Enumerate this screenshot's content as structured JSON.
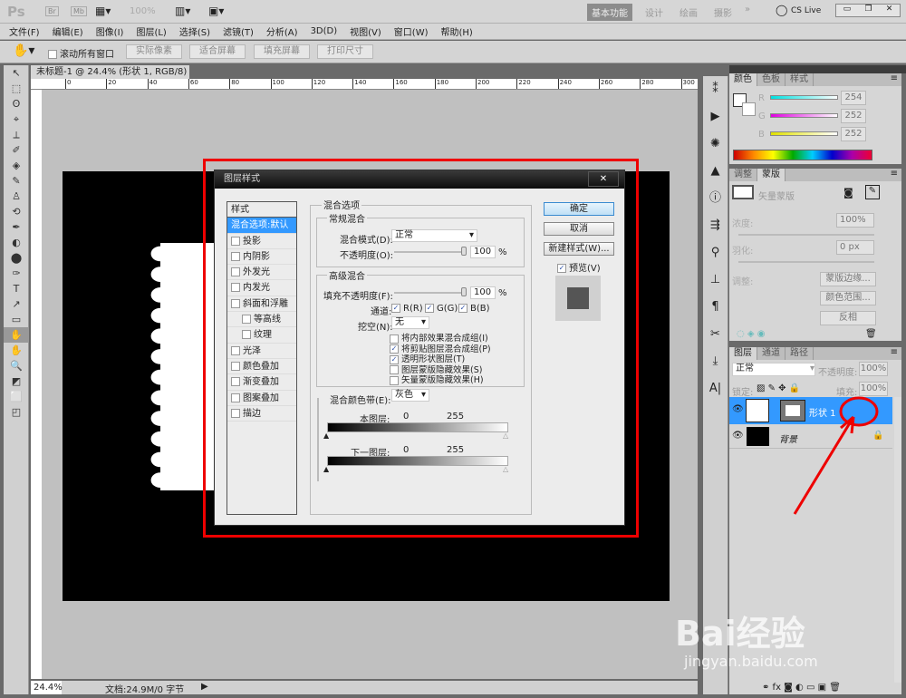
{
  "appbar": {
    "logo": "Ps",
    "br": "Br",
    "mb": "Mb",
    "zoom": "100%",
    "workspaces": [
      "基本功能",
      "设计",
      "绘画",
      "摄影"
    ],
    "more": "»",
    "cslive": "CS Live"
  },
  "menu": [
    "文件(F)",
    "编辑(E)",
    "图像(I)",
    "图层(L)",
    "选择(S)",
    "滤镜(T)",
    "分析(A)",
    "3D(D)",
    "视图(V)",
    "窗口(W)",
    "帮助(H)"
  ],
  "options": {
    "scroll_all": "滚动所有窗口",
    "buttons": [
      "实际像素",
      "适合屏幕",
      "填充屏幕",
      "打印尺寸"
    ]
  },
  "document": {
    "tab": "未标题-1 @ 24.4% (形状 1, RGB/8) *",
    "ruler_labels": [
      "0",
      "20",
      "40",
      "60",
      "80",
      "100",
      "120",
      "140",
      "160",
      "180",
      "200",
      "220",
      "240",
      "260",
      "280",
      "300"
    ]
  },
  "status": {
    "zoom": "24.4%",
    "doc": "文档:24.9M/0 字节"
  },
  "dialog": {
    "title": "图层样式",
    "close": "✕",
    "styles_header": "样式",
    "styles": [
      {
        "label": "混合选项:默认",
        "selected": true
      },
      {
        "label": "投影"
      },
      {
        "label": "内阴影"
      },
      {
        "label": "外发光"
      },
      {
        "label": "内发光"
      },
      {
        "label": "斜面和浮雕"
      },
      {
        "label": "等高线",
        "indent": true
      },
      {
        "label": "纹理",
        "indent": true
      },
      {
        "label": "光泽"
      },
      {
        "label": "颜色叠加"
      },
      {
        "label": "渐变叠加"
      },
      {
        "label": "图案叠加"
      },
      {
        "label": "描边"
      }
    ],
    "blend_options": "混合选项",
    "general": "常规混合",
    "blend_mode_label": "混合模式(D):",
    "blend_mode": "正常",
    "opacity_label": "不透明度(O):",
    "opacity": "100",
    "pct": "%",
    "advanced": "高级混合",
    "fill_label": "填充不透明度(F):",
    "fill": "100",
    "channels_label": "通道:",
    "channels": [
      {
        "label": "R(R)",
        "checked": true
      },
      {
        "label": "G(G)",
        "checked": true
      },
      {
        "label": "B(B)",
        "checked": true
      }
    ],
    "knockout_label": "挖空(N):",
    "knockout": "无",
    "options": [
      {
        "label": "将内部效果混合成组(I)",
        "checked": false
      },
      {
        "label": "将剪贴图层混合成组(P)",
        "checked": true
      },
      {
        "label": "透明形状图层(T)",
        "checked": true
      },
      {
        "label": "图层蒙版隐藏效果(S)",
        "checked": false
      },
      {
        "label": "矢量蒙版隐藏效果(H)",
        "checked": false
      }
    ],
    "blend_if_label": "混合颜色带(E):",
    "blend_if": "灰色",
    "this_layer": "本图层:",
    "underlying": "下一图层:",
    "min": "0",
    "max": "255",
    "ok": "确定",
    "cancel": "取消",
    "new_style": "新建样式(W)...",
    "preview": "预览(V)",
    "preview_checked": true
  },
  "color_panel": {
    "tabs": [
      "颜色",
      "色板",
      "样式"
    ],
    "channels": [
      {
        "label": "R",
        "value": "254",
        "color": "#00e0e0"
      },
      {
        "label": "G",
        "value": "252",
        "color": "#e000e0"
      },
      {
        "label": "B",
        "value": "252",
        "color": "#e0e000"
      }
    ]
  },
  "mask_panel": {
    "tabs": [
      "调整",
      "蒙版"
    ],
    "title": "矢量蒙版",
    "density_label": "浓度:",
    "density": "100%",
    "feather_label": "羽化:",
    "feather": "0 px",
    "refine_label": "调整:",
    "buttons": [
      "蒙版边缘...",
      "颜色范围...",
      "反相"
    ]
  },
  "layers_panel": {
    "tabs": [
      "图层",
      "通道",
      "路径"
    ],
    "mode": "正常",
    "opacity_label": "不透明度:",
    "opacity": "100%",
    "lock_label": "锁定:",
    "fill_label": "填充:",
    "fill": "100%",
    "layers": [
      {
        "name": "形状 1",
        "selected": true
      },
      {
        "name": "背景",
        "locked": true
      }
    ]
  },
  "watermark": {
    "brand": "Bai经验",
    "url": "jingyan.baidu.com"
  },
  "colors": {
    "accent": "#3399ff",
    "annotation": "#ff0000"
  }
}
